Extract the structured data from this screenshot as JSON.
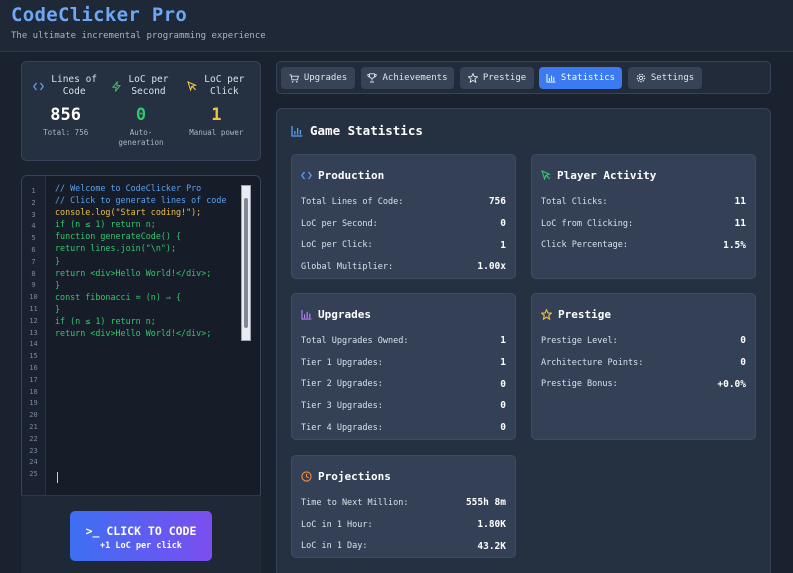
{
  "app": {
    "title": "CodeClicker Pro",
    "subtitle": "The ultimate incremental programming experience"
  },
  "stats": {
    "loc": {
      "label": "Lines of Code",
      "value": "856",
      "sub": "Total: 756",
      "icon": "code-icon",
      "color": "#ffffff"
    },
    "lps": {
      "label": "LoC per Second",
      "value": "0",
      "sub": "Auto-generation",
      "icon": "bolt-icon",
      "color": "#34c76a"
    },
    "lpc": {
      "label": "LoC per Click",
      "value": "1",
      "sub": "Manual power",
      "icon": "cursor-icon",
      "color": "#f0c43c"
    }
  },
  "editor": {
    "line_numbers": [
      "1",
      "2",
      "3",
      "4",
      "5",
      "6",
      "7",
      "8",
      "9",
      "10",
      "11",
      "12",
      "13",
      "14",
      "15",
      "16",
      "17",
      "18",
      "19",
      "20",
      "21",
      "22",
      "23",
      "24",
      "25"
    ],
    "lines": [
      {
        "text": "// Welcome to CodeClicker Pro",
        "style": "comment"
      },
      {
        "text": "// Click to generate lines of code",
        "style": "comment"
      },
      {
        "text": "console.log(\"Start coding!\");",
        "style": "yellow"
      },
      {
        "text": "if (n ≤ 1) return n;",
        "style": "green"
      },
      {
        "text": "function generateCode() {",
        "style": "green"
      },
      {
        "text": "return lines.join(\"\\n\");",
        "style": "green"
      },
      {
        "text": "}",
        "style": "green"
      },
      {
        "text": "return <div>Hello World!</div>;",
        "style": "green"
      },
      {
        "text": "}",
        "style": "green"
      },
      {
        "text": "const fibonacci = (n) ⇒ {",
        "style": "green"
      },
      {
        "text": "}",
        "style": "green"
      },
      {
        "text": "if (n ≤ 1) return n;",
        "style": "green"
      },
      {
        "text": "return <div>Hello World!</div>;",
        "style": "green"
      }
    ]
  },
  "click_button": {
    "label": ">_ CLICK TO CODE",
    "sub": "+1 LoC per click"
  },
  "tabs": [
    {
      "label": "Upgrades",
      "icon": "cart-icon",
      "active": false
    },
    {
      "label": "Achievements",
      "icon": "trophy-icon",
      "active": false
    },
    {
      "label": "Prestige",
      "icon": "star-icon",
      "active": false
    },
    {
      "label": "Statistics",
      "icon": "bar-chart-icon",
      "active": true
    },
    {
      "label": "Settings",
      "icon": "gear-icon",
      "active": false
    }
  ],
  "panel": {
    "title": "Game Statistics",
    "production": {
      "title": "Production",
      "rows": [
        {
          "label": "Total Lines of Code:",
          "value": "756"
        },
        {
          "label": "LoC per Second:",
          "value": "0"
        },
        {
          "label": "LoC per Click:",
          "value": "1"
        },
        {
          "label": "Global Multiplier:",
          "value": "1.00x"
        }
      ]
    },
    "activity": {
      "title": "Player Activity",
      "rows": [
        {
          "label": "Total Clicks:",
          "value": "11"
        },
        {
          "label": "LoC from Clicking:",
          "value": "11"
        },
        {
          "label": "Click Percentage:",
          "value": "1.5%"
        }
      ]
    },
    "upgrades": {
      "title": "Upgrades",
      "rows": [
        {
          "label": "Total Upgrades Owned:",
          "value": "1"
        },
        {
          "label": "Tier 1 Upgrades:",
          "value": "1"
        },
        {
          "label": "Tier 2 Upgrades:",
          "value": "0"
        },
        {
          "label": "Tier 3 Upgrades:",
          "value": "0"
        },
        {
          "label": "Tier 4 Upgrades:",
          "value": "0"
        }
      ]
    },
    "prestige": {
      "title": "Prestige",
      "rows": [
        {
          "label": "Prestige Level:",
          "value": "0"
        },
        {
          "label": "Architecture Points:",
          "value": "0"
        },
        {
          "label": "Prestige Bonus:",
          "value": "+0.0%"
        }
      ]
    },
    "projections": {
      "title": "Projections",
      "rows": [
        {
          "label": "Time to Next Million:",
          "value": "555h 8m"
        },
        {
          "label": "LoC in 1 Hour:",
          "value": "1.80K"
        },
        {
          "label": "LoC in 1 Day:",
          "value": "43.2K"
        }
      ]
    }
  },
  "colors": {
    "accent": "#3b7af0",
    "code_blue": "#5aa0f0",
    "green": "#34c76a",
    "yellow": "#f0c43c",
    "purple": "#b57cf2",
    "orange": "#f0913c"
  }
}
